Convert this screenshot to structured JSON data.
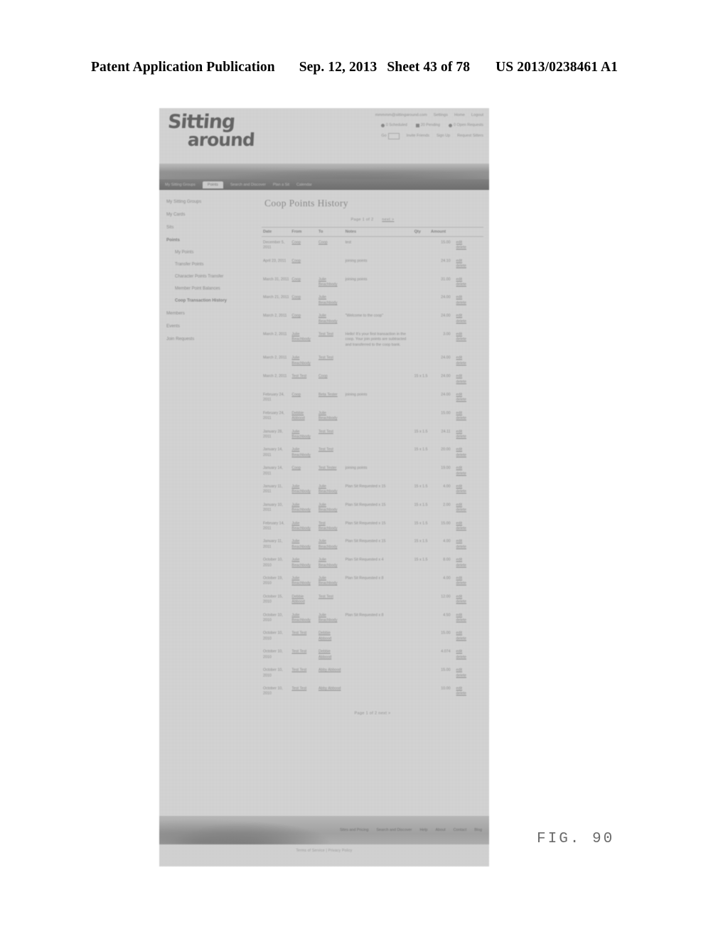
{
  "patent": {
    "publication": "Patent Application Publication",
    "date": "Sep. 12, 2013",
    "sheet": "Sheet 43 of 78",
    "number": "US 2013/0238461 A1",
    "figure": "FIG. 90"
  },
  "site": {
    "logo_line1": "Sitting",
    "logo_line2": "around",
    "account": {
      "email": "mmmmm@sittingaround.com",
      "settings": "Settings",
      "home": "Home",
      "logout": "Logout"
    },
    "status": [
      {
        "icon": "circle-icon",
        "label": "0 Scheduled"
      },
      {
        "icon": "square-icon",
        "label": "20 Pending"
      },
      {
        "icon": "circle-icon",
        "label": "0 Open Requests"
      }
    ],
    "utility": [
      {
        "icon": "search-icon",
        "label": "Go"
      },
      {
        "icon": "none",
        "label": "Invite Friends"
      },
      {
        "icon": "none",
        "label": "Sign Up"
      },
      {
        "icon": "none",
        "label": "Request Sitters"
      }
    ],
    "nav": [
      {
        "label": "My Sitting Groups",
        "active": false
      },
      {
        "label": "Points",
        "active": true
      },
      {
        "label": "Search and Discover",
        "active": false
      },
      {
        "label": "Plan a Sit",
        "active": false
      },
      {
        "label": "Calendar",
        "active": false
      }
    ]
  },
  "sidebar": {
    "items": [
      {
        "label": "My Sitting Groups",
        "bold": false,
        "sub": false
      },
      {
        "label": "My Cards",
        "bold": false,
        "sub": false
      },
      {
        "label": "Sits",
        "bold": false,
        "sub": false
      },
      {
        "label": "Points",
        "bold": true,
        "sub": false
      },
      {
        "label": "My Points",
        "bold": false,
        "sub": true
      },
      {
        "label": "Transfer Points",
        "bold": false,
        "sub": true
      },
      {
        "label": "Character Points Transfer",
        "bold": false,
        "sub": true
      },
      {
        "label": "Member Point Balances",
        "bold": false,
        "sub": true
      },
      {
        "label": "Coop Transaction History",
        "bold": true,
        "sub": true
      },
      {
        "label": "Members",
        "bold": false,
        "sub": false
      },
      {
        "label": "Events",
        "bold": false,
        "sub": false
      },
      {
        "label": "Join Requests",
        "bold": false,
        "sub": false
      }
    ]
  },
  "main": {
    "title": "Coop Points History",
    "pager_top": "Page 1 of 2",
    "pager_top_next": "next >",
    "pager_bottom": "Page 1 of 2",
    "pager_bottom_next": "next >",
    "table": {
      "columns": [
        "Date",
        "From",
        "To",
        "Notes",
        "Qty",
        "Amount",
        ""
      ],
      "action_edit": "edit",
      "action_delete": "delete",
      "rows": [
        {
          "date": "December 5, 2011",
          "from": "Coop",
          "to": "Coop",
          "notes": "test",
          "qty": "",
          "amount": "15.00"
        },
        {
          "date": "April 23, 2011",
          "from": "Coop",
          "to": "",
          "notes": "joining points",
          "qty": "",
          "amount": "24.10"
        },
        {
          "date": "March 31, 2011",
          "from": "Coop",
          "to": "Julie Beachbody",
          "notes": "joining points",
          "qty": "",
          "amount": "31.00"
        },
        {
          "date": "March 21, 2011",
          "from": "Coop",
          "to": "Julie Beachbody",
          "notes": "",
          "qty": "",
          "amount": "24.00"
        },
        {
          "date": "March 2, 2011",
          "from": "Coop",
          "to": "Julie Beachbody",
          "notes": "\"Welcome to the coop\"",
          "qty": "",
          "amount": "24.00"
        },
        {
          "date": "March 2, 2011",
          "from": "Julie Beachbody",
          "to": "Test Test",
          "notes": "Hello! It's your first transaction in the coop. Your join points are subtracted and transferred to the coop bank.",
          "qty": "",
          "amount": "3.00"
        },
        {
          "date": "March 2, 2011",
          "from": "Julie Beachbody",
          "to": "Test Test",
          "notes": "",
          "qty": "",
          "amount": "24.00"
        },
        {
          "date": "March 2, 2011",
          "from": "Test Test",
          "to": "Coop",
          "notes": "",
          "qty": "15 x 1.5",
          "amount": "24.00"
        },
        {
          "date": "February 24, 2011",
          "from": "Coop",
          "to": "Beta Tester",
          "notes": "joining points",
          "qty": "",
          "amount": "24.00"
        },
        {
          "date": "February 24, 2011",
          "from": "Debbie Abbood",
          "to": "Julie Beachbody",
          "notes": "",
          "qty": "",
          "amount": "15.00"
        },
        {
          "date": "January 28, 2011",
          "from": "Julie Beachbody",
          "to": "Test Test",
          "notes": "",
          "qty": "15 x 1.5",
          "amount": "24.11"
        },
        {
          "date": "January 14, 2011",
          "from": "Julie Beachbody",
          "to": "Test Test",
          "notes": "",
          "qty": "15 x 1.5",
          "amount": "20.00"
        },
        {
          "date": "January 14, 2011",
          "from": "Coop",
          "to": "Test Tester",
          "notes": "joining points",
          "qty": "",
          "amount": "19.00"
        },
        {
          "date": "January 11, 2011",
          "from": "Julie Beachbody",
          "to": "Julie Beachbody",
          "notes": "Plan Sit Requested x 15",
          "qty": "15 x 1.5",
          "amount": "4.00"
        },
        {
          "date": "January 10, 2011",
          "from": "Julie Beachbody",
          "to": "Julie Beachbody",
          "notes": "Plan Sit Requested x 15",
          "qty": "15 x 1.5",
          "amount": "2.00"
        },
        {
          "date": "February 14, 2011",
          "from": "Julie Beachbody",
          "to": "Test Beachbody",
          "notes": "Plan Sit Requested x 15",
          "qty": "15 x 1.5",
          "amount": "15.00"
        },
        {
          "date": "January 11, 2011",
          "from": "Julie Beachbody",
          "to": "Julie Beachbody",
          "notes": "Plan Sit Requested x 15",
          "qty": "15 x 1.5",
          "amount": "4.00"
        },
        {
          "date": "October 10, 2010",
          "from": "Julie Beachbody",
          "to": "Julie Beachbody",
          "notes": "Plan Sit Requested x 4",
          "qty": "15 x 1.5",
          "amount": "8.00"
        },
        {
          "date": "October 19, 2010",
          "from": "Julie Beachbody",
          "to": "Julie Beachbody",
          "notes": "Plan Sit Requested x 8",
          "qty": "",
          "amount": "4.00"
        },
        {
          "date": "October 15, 2010",
          "from": "Debbie Abbood",
          "to": "Test Test",
          "notes": "",
          "qty": "",
          "amount": "12.00"
        },
        {
          "date": "October 10, 2010",
          "from": "Julie Beachbody",
          "to": "Julie Beachbody",
          "notes": "Plan Sit Requested x 8",
          "qty": "",
          "amount": "4.50"
        },
        {
          "date": "October 10, 2010",
          "from": "Test Test",
          "to": "Debbie Abbood",
          "notes": "",
          "qty": "",
          "amount": "15.00"
        },
        {
          "date": "October 10, 2010",
          "from": "Test Test",
          "to": "Debbie Abbood",
          "notes": "",
          "qty": "",
          "amount": "4.074"
        },
        {
          "date": "October 10, 2010",
          "from": "Test Test",
          "to": "Abby Abbood",
          "notes": "",
          "qty": "",
          "amount": "15.00"
        },
        {
          "date": "October 10, 2010",
          "from": "Test Test",
          "to": "Abby Abbood",
          "notes": "",
          "qty": "",
          "amount": "10.00"
        }
      ]
    }
  },
  "footer": {
    "links": [
      "Sites and Pricing",
      "Search and Discover",
      "Help",
      "About",
      "Contact",
      "Blog"
    ],
    "copyright": "Terms of Service | Privacy Policy"
  }
}
